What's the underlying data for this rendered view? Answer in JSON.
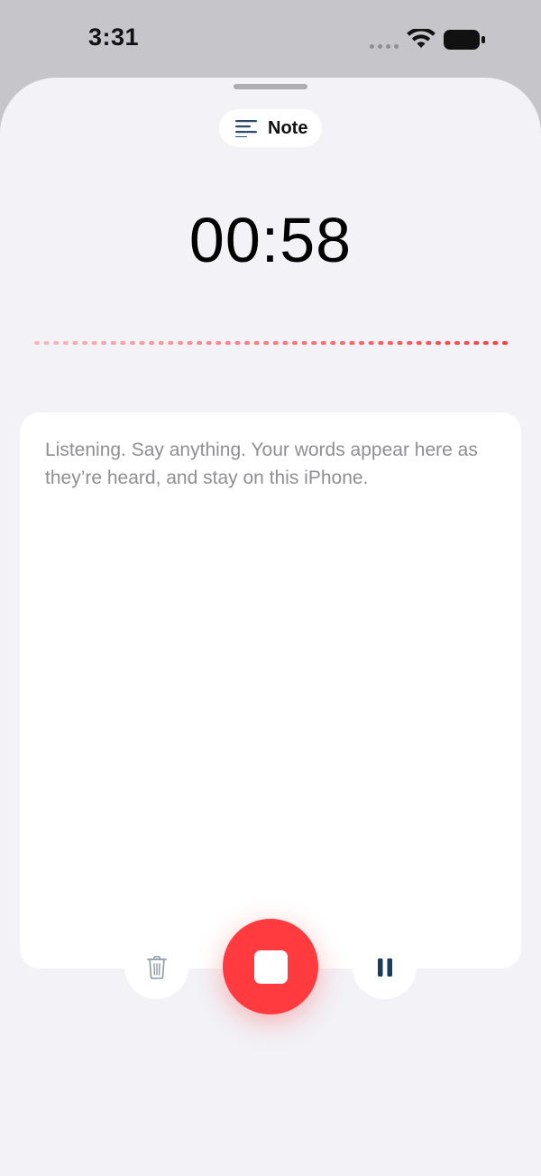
{
  "status_bar": {
    "time": "3:31"
  },
  "mode": {
    "label": "Note",
    "icon": "text-align-left-icon"
  },
  "timer": {
    "elapsed": "00:58"
  },
  "transcript": {
    "placeholder": "Listening. Say anything. Your words appear here as they’re heard, and stay on this iPhone."
  },
  "controls": {
    "delete_icon": "trash-icon",
    "stop_icon": "stop-icon",
    "pause_icon": "pause-icon"
  },
  "colors": {
    "accent_red": "#ff3b3f",
    "pause_navy": "#1c3a5e",
    "note_icon": "#2c4a6e",
    "sheet_bg": "#f2f2f7"
  }
}
